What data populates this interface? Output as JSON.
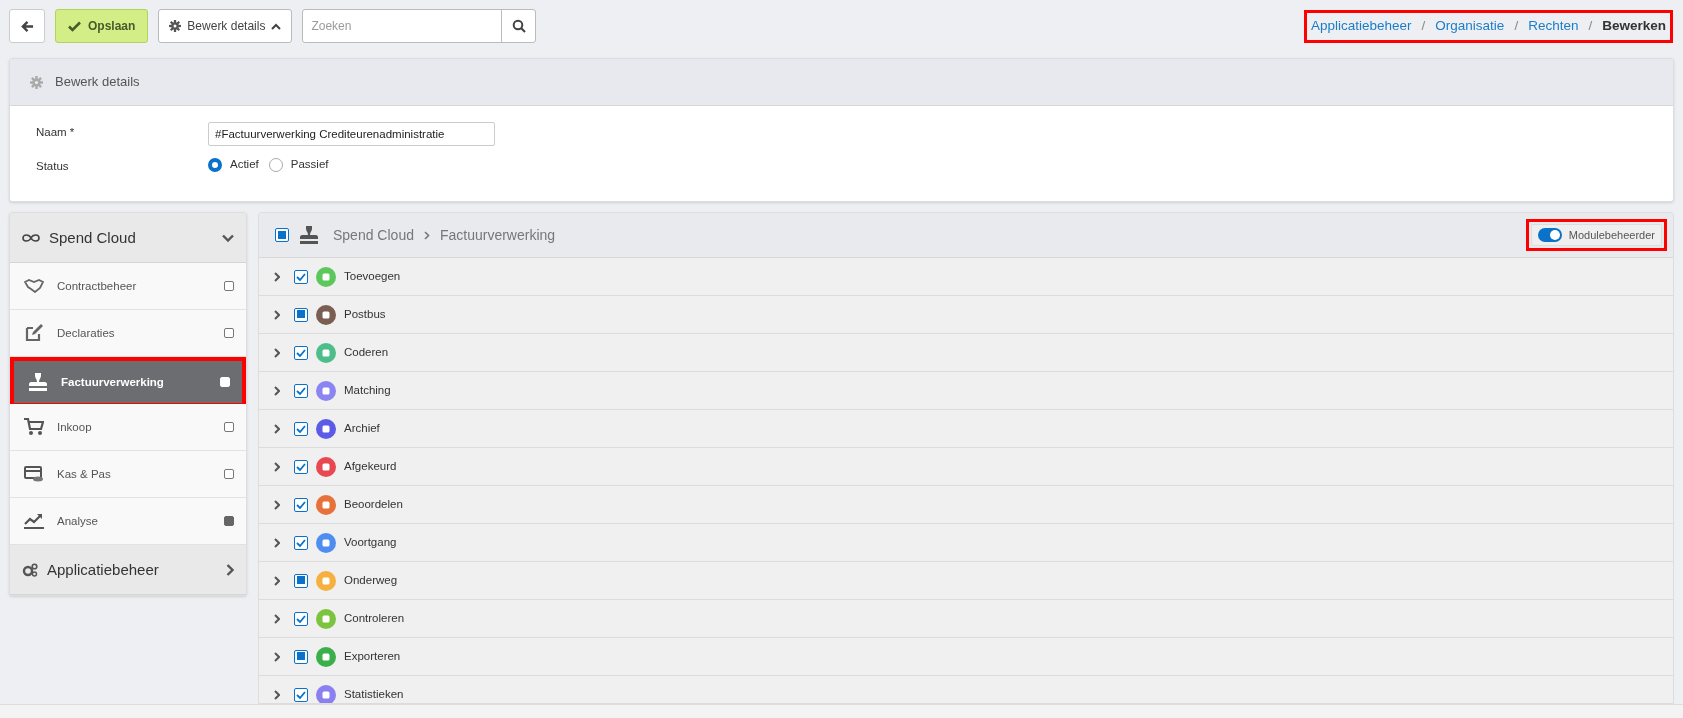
{
  "toolbar": {
    "save": "Opslaan",
    "details_menu": {
      "label": "Bewerk details",
      "expanded": true
    },
    "search": {
      "placeholder": "Zoeken"
    }
  },
  "breadcrumb": {
    "highlighted": true,
    "items": [
      {
        "label": "Applicatiebeheer",
        "current": false
      },
      {
        "separator": "/"
      },
      {
        "label": "Organisatie",
        "current": false
      },
      {
        "separator": "/"
      },
      {
        "label": "Rechten",
        "current": false
      },
      {
        "separator": "/"
      },
      {
        "label": "Bewerken",
        "current": true
      }
    ]
  },
  "details": {
    "title": "Bewerk details",
    "fields": [
      {
        "kind": "text",
        "label": "Naam *",
        "value": "#Factuurverwerking Crediteurenadministratie"
      },
      {
        "kind": "radio",
        "label": "Status",
        "options": [
          {
            "label": "Actief",
            "selected": true
          },
          {
            "label": "Passief",
            "selected": false
          }
        ]
      }
    ]
  },
  "sidebar": {
    "groups": [
      {
        "title": "Spend Cloud",
        "expanded": true,
        "items": [
          {
            "label": "Contractbeheer",
            "selected": false,
            "highlighted": false,
            "partial": false
          },
          {
            "label": "Declaraties",
            "selected": false,
            "highlighted": false,
            "partial": false
          },
          {
            "label": "Factuurverwerking",
            "selected": true,
            "highlighted": true,
            "partial": false
          },
          {
            "label": "Inkoop",
            "selected": false,
            "highlighted": false,
            "partial": false
          },
          {
            "label": "Kas & Pas",
            "selected": false,
            "highlighted": false,
            "partial": false
          },
          {
            "label": "Analyse",
            "selected": false,
            "highlighted": false,
            "partial": true
          }
        ]
      },
      {
        "title": "Applicatiebeheer",
        "expanded": false
      }
    ]
  },
  "panel": {
    "checked": false,
    "partial": true,
    "path": [
      "Spend Cloud",
      "Factuurverwerking"
    ],
    "toggle": {
      "label": "Modulebeheerder",
      "on": true,
      "highlighted": true
    },
    "rows": [
      {
        "label": "Toevoegen",
        "checked": true,
        "partial": false,
        "color": "#5cc85c"
      },
      {
        "label": "Postbus",
        "checked": false,
        "partial": true,
        "color": "#7b5e52"
      },
      {
        "label": "Coderen",
        "checked": true,
        "partial": false,
        "color": "#4dbd8a"
      },
      {
        "label": "Matching",
        "checked": true,
        "partial": false,
        "color": "#8a85f0"
      },
      {
        "label": "Archief",
        "checked": true,
        "partial": false,
        "color": "#5b5be8"
      },
      {
        "label": "Afgekeurd",
        "checked": true,
        "partial": false,
        "color": "#e84850"
      },
      {
        "label": "Beoordelen",
        "checked": true,
        "partial": false,
        "color": "#e8703a"
      },
      {
        "label": "Voortgang",
        "checked": true,
        "partial": false,
        "color": "#4f8ef0"
      },
      {
        "label": "Onderweg",
        "checked": false,
        "partial": true,
        "color": "#f5b040"
      },
      {
        "label": "Controleren",
        "checked": true,
        "partial": false,
        "color": "#7cc440"
      },
      {
        "label": "Exporteren",
        "checked": false,
        "partial": true,
        "color": "#3bb04a"
      },
      {
        "label": "Statistieken",
        "checked": true,
        "partial": false,
        "color": "#8a80f0"
      }
    ]
  }
}
